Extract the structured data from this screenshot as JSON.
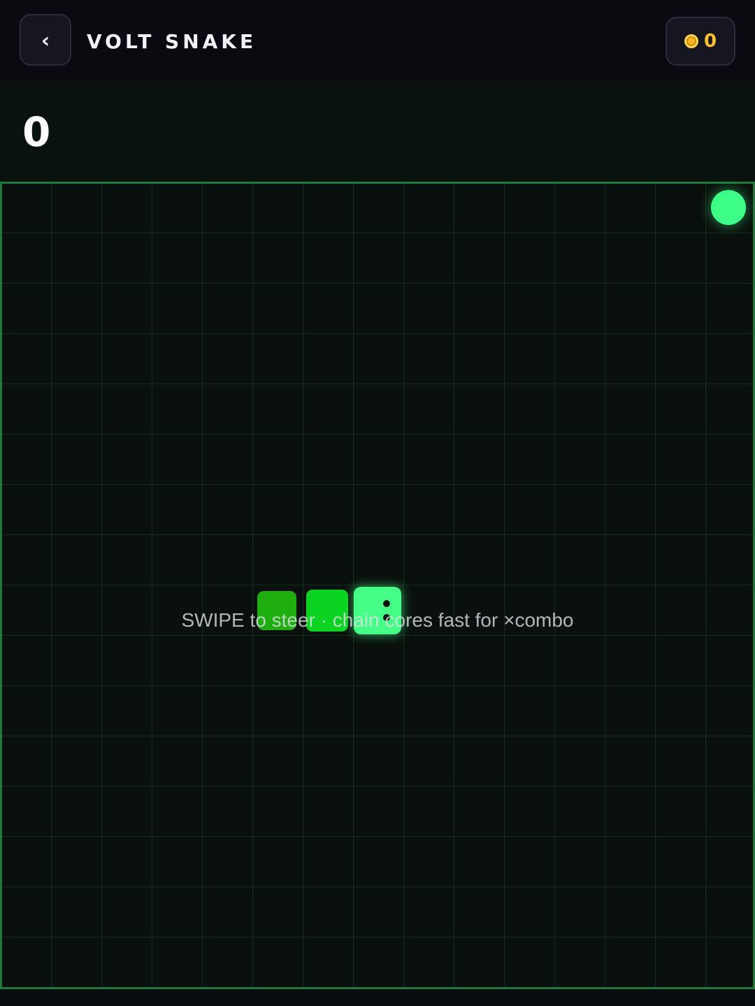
{
  "header": {
    "back_label": "‹",
    "title": "VOLT SNAKE",
    "coins": "0"
  },
  "score": "0",
  "board": {
    "hint": "SWIPE to steer · chain cores fast for ×combo"
  },
  "colors": {
    "food": "#3dff88",
    "snake_head": "#46ff86",
    "snake_mid": "#0ad421",
    "snake_tail": "#1fae10",
    "board_border": "#1f7a3a",
    "coin": "#ffc22e"
  },
  "icons": {
    "back": "chevron-left-icon",
    "coin": "coin-icon"
  }
}
